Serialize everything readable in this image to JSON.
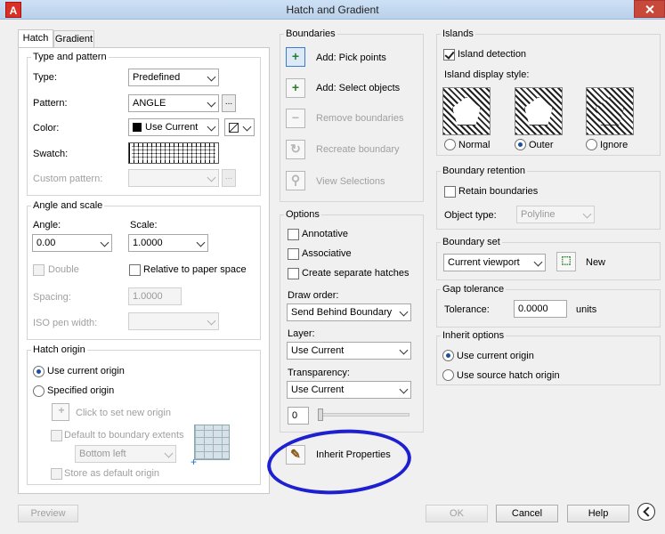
{
  "window": {
    "title": "Hatch and Gradient",
    "app_icon": "A"
  },
  "tabs": [
    {
      "label": "Hatch"
    },
    {
      "label": "Gradient"
    }
  ],
  "type_pattern": {
    "group": "Type and pattern",
    "type_label": "Type:",
    "type_value": "Predefined",
    "pattern_label": "Pattern:",
    "pattern_value": "ANGLE",
    "pattern_btn": "...",
    "color_label": "Color:",
    "color_value": "Use Current",
    "swatch_label": "Swatch:",
    "custom_label": "Custom pattern:",
    "custom_btn": "..."
  },
  "angle_scale": {
    "group": "Angle and scale",
    "angle_label": "Angle:",
    "angle_value": "0.00",
    "scale_label": "Scale:",
    "scale_value": "1.0000",
    "double_label": "Double",
    "relative_label": "Relative to paper space",
    "spacing_label": "Spacing:",
    "spacing_value": "1.0000",
    "iso_label": "ISO pen width:"
  },
  "hatch_origin": {
    "group": "Hatch origin",
    "use_current": "Use current origin",
    "specified": "Specified origin",
    "click_set": "Click to set new origin",
    "default_extents": "Default to boundary extents",
    "position_value": "Bottom left",
    "store_default": "Store as default origin"
  },
  "boundaries": {
    "group": "Boundaries",
    "add_pick": "Add: Pick points",
    "add_select": "Add: Select objects",
    "remove": "Remove boundaries",
    "recreate": "Recreate boundary",
    "view": "View Selections"
  },
  "options": {
    "group": "Options",
    "annotative": "Annotative",
    "associative": "Associative",
    "separate": "Create separate hatches",
    "draw_order_label": "Draw order:",
    "draw_order_value": "Send Behind Boundary",
    "layer_label": "Layer:",
    "layer_value": "Use Current",
    "transparency_label": "Transparency:",
    "transparency_value": "Use Current",
    "transparency_number": "0",
    "inherit": "Inherit Properties"
  },
  "islands": {
    "group": "Islands",
    "detection": "Island detection",
    "display_style": "Island display style:",
    "normal": "Normal",
    "outer": "Outer",
    "ignore": "Ignore"
  },
  "retention": {
    "group": "Boundary retention",
    "retain": "Retain boundaries",
    "object_type_label": "Object type:",
    "object_type_value": "Polyline"
  },
  "boundary_set": {
    "group": "Boundary set",
    "value": "Current viewport",
    "new_label": "New"
  },
  "gap": {
    "group": "Gap tolerance",
    "label": "Tolerance:",
    "value": "0.0000",
    "units": "units"
  },
  "inherit_opts": {
    "group": "Inherit options",
    "current": "Use current origin",
    "source": "Use source hatch origin"
  },
  "buttons": {
    "preview": "Preview",
    "ok": "OK",
    "cancel": "Cancel",
    "help": "Help"
  },
  "colors": {
    "annotation_ellipse": "#1d1fd0",
    "title_bar": "#c5d9f1"
  }
}
